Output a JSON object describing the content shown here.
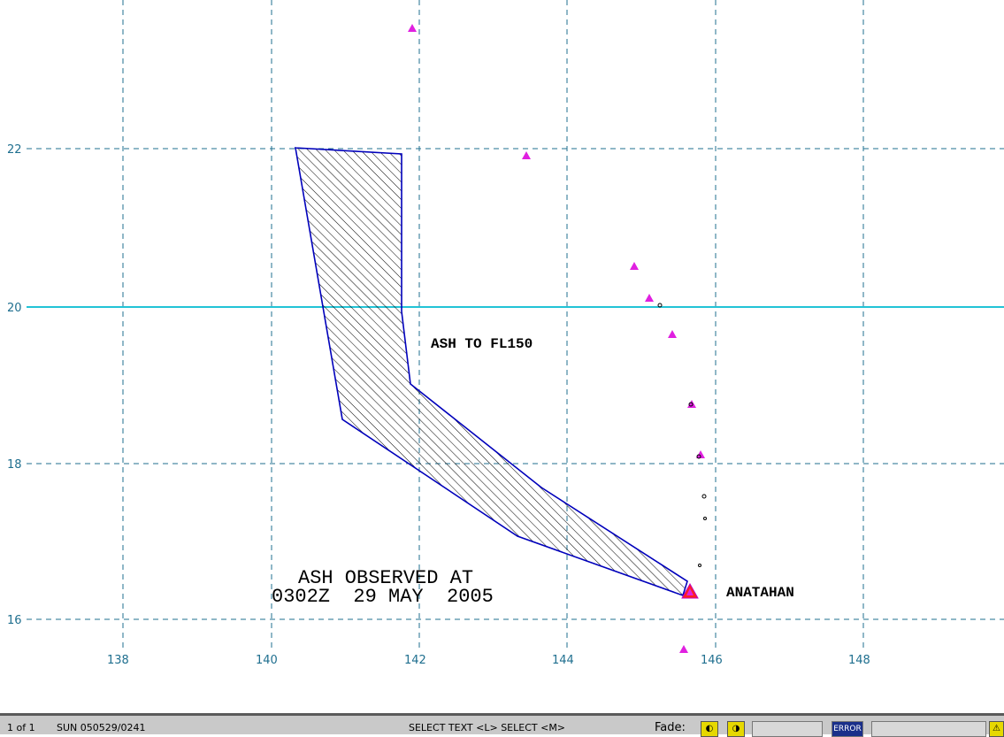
{
  "map": {
    "x_ticks": [
      "138",
      "140",
      "142",
      "144",
      "146",
      "148"
    ],
    "y_ticks": [
      "22",
      "20",
      "18",
      "16"
    ],
    "ash_label": "ASH TO FL150",
    "observed_line1": "ASH OBSERVED AT",
    "observed_line2": "0302Z  29 MAY  2005",
    "volcano_name": "ANATAHAN",
    "colors": {
      "grid": "#1f6f8f",
      "equator_line": "#22c3d6",
      "polygon": "#0000bb",
      "volcano_marker": "#e020e0"
    }
  },
  "statusbar": {
    "frame": "1 of 1",
    "file": "SUN 050529/0241",
    "mode": "SELECT TEXT  <L>  SELECT  <M>",
    "fade_label": "Fade:",
    "error_label": "ERROR"
  }
}
